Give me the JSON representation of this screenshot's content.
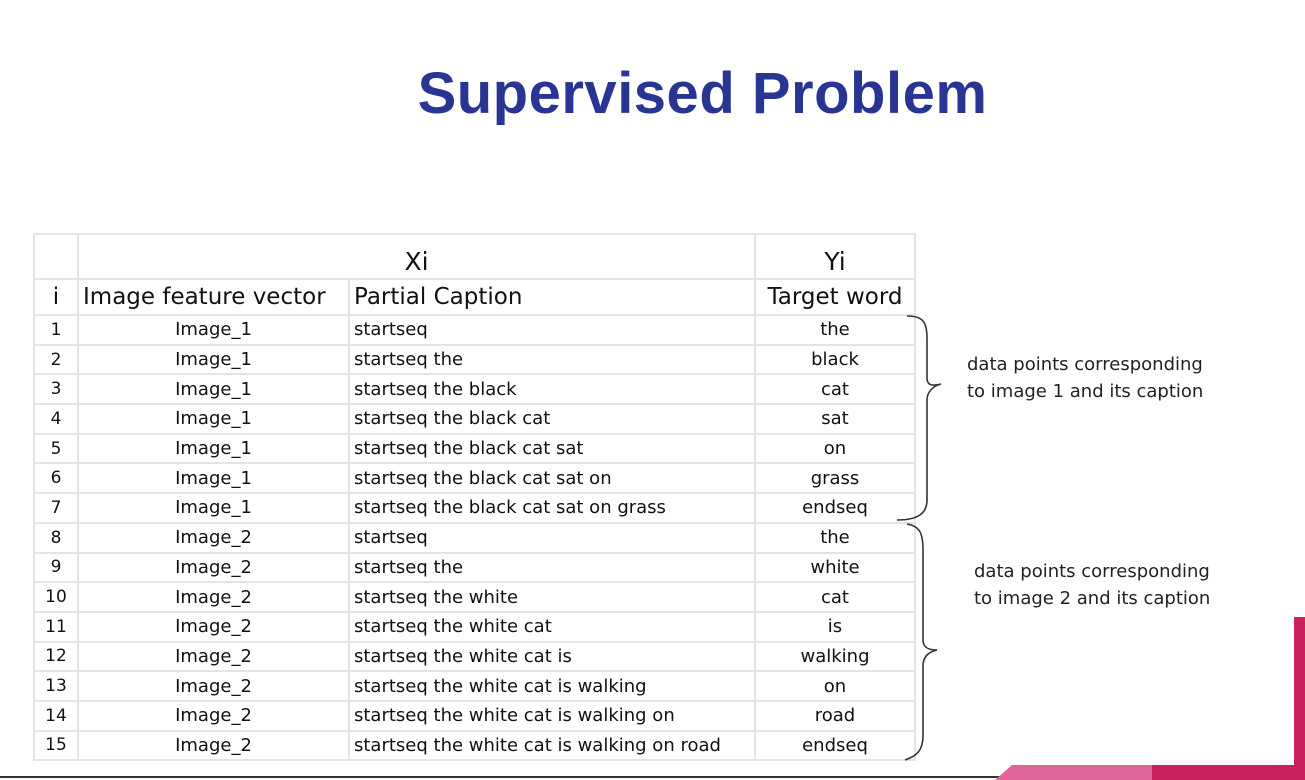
{
  "title": "Supervised Problem",
  "table": {
    "group_headers": {
      "xi": "Xi",
      "yi": "Yi"
    },
    "columns": {
      "i": "i",
      "image": "Image feature vector",
      "caption": "Partial Caption",
      "target": "Target word"
    },
    "rows": [
      {
        "i": "1",
        "image": "Image_1",
        "caption": "startseq",
        "target": "the"
      },
      {
        "i": "2",
        "image": "Image_1",
        "caption": "startseq the",
        "target": "black"
      },
      {
        "i": "3",
        "image": "Image_1",
        "caption": "startseq the black",
        "target": "cat"
      },
      {
        "i": "4",
        "image": "Image_1",
        "caption": "startseq the black cat",
        "target": "sat"
      },
      {
        "i": "5",
        "image": "Image_1",
        "caption": "startseq the black cat sat",
        "target": "on"
      },
      {
        "i": "6",
        "image": "Image_1",
        "caption": "startseq the black cat sat on",
        "target": "grass"
      },
      {
        "i": "7",
        "image": "Image_1",
        "caption": "startseq the black cat sat on grass",
        "target": "endseq"
      },
      {
        "i": "8",
        "image": "Image_2",
        "caption": "startseq",
        "target": "the"
      },
      {
        "i": "9",
        "image": "Image_2",
        "caption": "startseq the",
        "target": "white"
      },
      {
        "i": "10",
        "image": "Image_2",
        "caption": "startseq the white",
        "target": "cat"
      },
      {
        "i": "11",
        "image": "Image_2",
        "caption": "startseq the white cat",
        "target": "is"
      },
      {
        "i": "12",
        "image": "Image_2",
        "caption": "startseq the white cat is",
        "target": "walking"
      },
      {
        "i": "13",
        "image": "Image_2",
        "caption": "startseq the white cat is walking",
        "target": "on"
      },
      {
        "i": "14",
        "image": "Image_2",
        "caption": "startseq the white cat is walking on",
        "target": "road"
      },
      {
        "i": "15",
        "image": "Image_2",
        "caption": "startseq the white cat is walking on road",
        "target": "endseq"
      }
    ]
  },
  "annotations": {
    "group1": {
      "line1": "data points corresponding",
      "line2": "to image 1 and its caption"
    },
    "group2": {
      "line1": "data points corresponding",
      "line2": "to image 2 and its caption"
    }
  },
  "colors": {
    "title": "#283593",
    "accent_pink": "#e0649a",
    "accent_crimson": "#c9205e",
    "grid": "#e4e4e4"
  }
}
